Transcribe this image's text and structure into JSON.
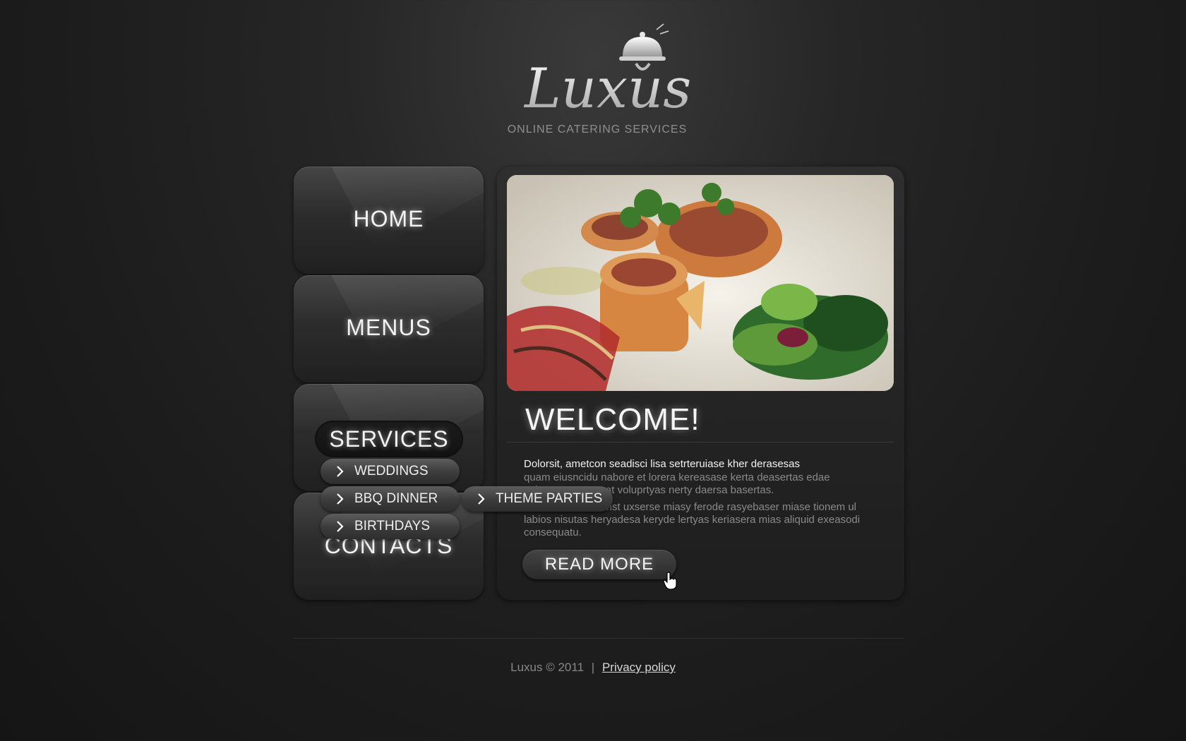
{
  "brand": {
    "logo_text": "Luxus",
    "tagline": "ONLINE CATERING SERVICES"
  },
  "nav": {
    "items": [
      {
        "label": "HOME"
      },
      {
        "label": "MENUS"
      },
      {
        "label": "SERVICES"
      },
      {
        "label": "CONTACTS"
      }
    ],
    "submenu": [
      {
        "label": "WEDDINGS"
      },
      {
        "label": "BBQ DINNER"
      },
      {
        "label": "BIRTHDAYS"
      }
    ],
    "flyout": [
      {
        "label": "THEME PARTIES"
      }
    ]
  },
  "content": {
    "heading": "WELCOME!",
    "lead": "Dolorsit, ametcon seadisci lisa setrteruiase kher derasesas",
    "para1": "quam eiusncidu nabore et lorera kereasase kerta deasertas edae voluptatem quaerat voluprtyas nerty daersa basertas.",
    "para2": "Ut eniem ad minimst uxserse miasy ferode rasyebaser miase tionem ul labios nisutas heryadesa keryde lertyas keriasera mias aliquid exeasodi consequatu.",
    "read_more": "READ MORE"
  },
  "footer": {
    "copyright": "Luxus © 2011",
    "separator": "|",
    "privacy_link": "Privacy policy"
  },
  "icons": {
    "logo": "cloche-icon",
    "chevron": "chevron-right-icon",
    "cursor": "hand-pointer-icon"
  }
}
